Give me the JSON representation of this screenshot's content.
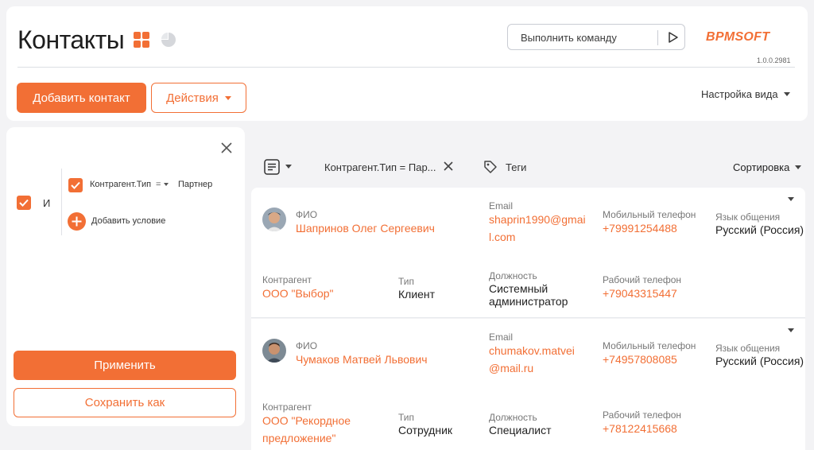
{
  "header": {
    "title": "Контакты",
    "command_placeholder": "Выполнить команду",
    "logo_text": "BPMSOFT",
    "version": "1.0.0.2981",
    "add_contact_label": "Добавить контакт",
    "actions_label": "Действия",
    "view_settings_label": "Настройка вида"
  },
  "filter_panel": {
    "group_operator": "И",
    "condition": {
      "field": "Контрагент.Тип",
      "operator": "=",
      "value": "Партнер"
    },
    "add_condition_label": "Добавить условие",
    "apply_label": "Применить",
    "save_as_label": "Сохранить как"
  },
  "toolbar": {
    "filter_chip": "Контрагент.Тип = Пар...",
    "tags_label": "Теги",
    "sort_label": "Сортировка"
  },
  "labels": {
    "fio": "ФИО",
    "email": "Email",
    "mobile": "Мобильный телефон",
    "language": "Язык общения",
    "account": "Контрагент",
    "type": "Тип",
    "position": "Должность",
    "work_phone": "Рабочий телефон"
  },
  "contacts": [
    {
      "name": "Шапринов Олег Сергеевич",
      "email_line1": "shaprin1990@gmai",
      "email_line2": "l.com",
      "mobile": "+79991254488",
      "language": "Русский (Россия)",
      "account_line1": "ООО \"Выбор\"",
      "account_line2": "",
      "type": "Клиент",
      "position_line1": "Системный",
      "position_line2": "администратор",
      "work_phone": "+79043315447"
    },
    {
      "name": "Чумаков Матвей Львович",
      "email_line1": "chumakov.matvei",
      "email_line2": "@mail.ru",
      "mobile": "+74957808085",
      "language": "Русский (Россия)",
      "account_line1": "ООО \"Рекордное",
      "account_line2": "предложение\"",
      "type": "Сотрудник",
      "position_line1": "Специалист",
      "position_line2": "",
      "work_phone": "+78122415668"
    }
  ],
  "colors": {
    "accent": "#f26f35",
    "background": "#f3f3f5",
    "card": "#ffffff"
  }
}
